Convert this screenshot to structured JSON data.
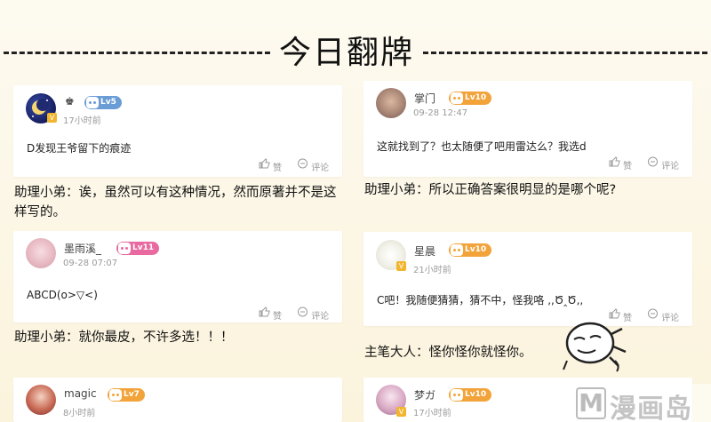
{
  "header": {
    "title": "今日翻牌"
  },
  "comments": [
    {
      "user": "♚",
      "level": "Lv5",
      "time": "17小时前",
      "text": "D发现王爷留下的痕迹",
      "like": "赞",
      "comment": "评论",
      "reply": "助理小弟：诶，虽然可以有这种情况，然而原著并不是这样写的。"
    },
    {
      "user": "掌门",
      "level": "Lv10",
      "time": "09-28 12:47",
      "text": "这就找到了？也太随便了吧用雷达么？我选d",
      "like": "赞",
      "comment": "评论",
      "reply": "助理小弟：所以正确答案很明显的是哪个呢?"
    },
    {
      "user": "墨雨溪_",
      "level": "Lv11",
      "time": "09-28 07:07",
      "text": "ABCD(o>▽<)",
      "like": "赞",
      "comment": "评论",
      "reply": "助理小弟：就你最皮，不许多选！！！"
    },
    {
      "user": "星晨",
      "level": "Lv10",
      "time": "21小时前",
      "text": "C吧！我随便猜猜，猜不中，怪我咯 ,,Ծ‸Ծ,,",
      "like": "赞",
      "comment": "评论",
      "reply": "主笔大人：怪你怪你就怪你。"
    },
    {
      "user": "magic",
      "level": "Lv7",
      "time": "8小时前",
      "text": "",
      "like": "",
      "comment": "",
      "reply": ""
    },
    {
      "user": "梦ガ",
      "level": "Lv10",
      "time": "17小时前",
      "text": "",
      "like": "",
      "comment": "",
      "reply": ""
    }
  ],
  "watermark": {
    "logo": "M",
    "text": "漫画岛"
  },
  "colors": {
    "lv_blue": "#6a9cd6",
    "lv_orange": "#f2a33a",
    "lv_pink": "#e86aa0",
    "vip_badge": "#f3b52e"
  }
}
